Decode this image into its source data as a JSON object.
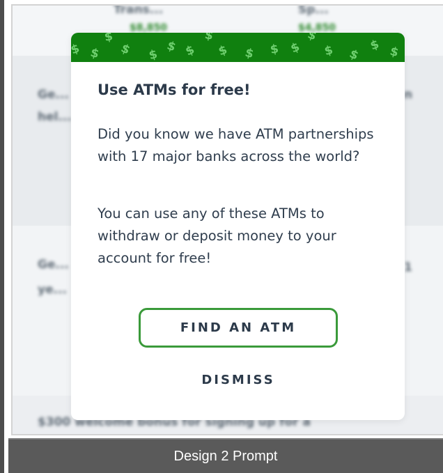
{
  "background": {
    "rows": [
      {
        "left": "Trans...",
        "right": "Sp...",
        "left_sub": "$8,850",
        "right_sub": "$4,850"
      },
      {
        "lines": [
          "Ge...",
          "hel..."
        ],
        "right": "n"
      },
      {
        "lines": [
          "Ge...",
          "ye..."
        ],
        "right": "1"
      },
      {
        "lines": [
          "$300 welcome bonus for signing up for a"
        ]
      }
    ]
  },
  "modal": {
    "title": "Use ATMs for free!",
    "paragraph_1": "Did you know we have ATM partnerships with 17 major banks across the world?",
    "paragraph_2": "You can use any of these ATMs to withdraw or deposit money to your account for free!",
    "find_button_label": "FIND AN ATM",
    "dismiss_button_label": "DISMISS",
    "banner_icon": "dollar-sign-pattern",
    "banner_color": "#10800f",
    "accent_color": "#3a9a3a"
  },
  "caption": {
    "text": "Design 2 Prompt"
  }
}
